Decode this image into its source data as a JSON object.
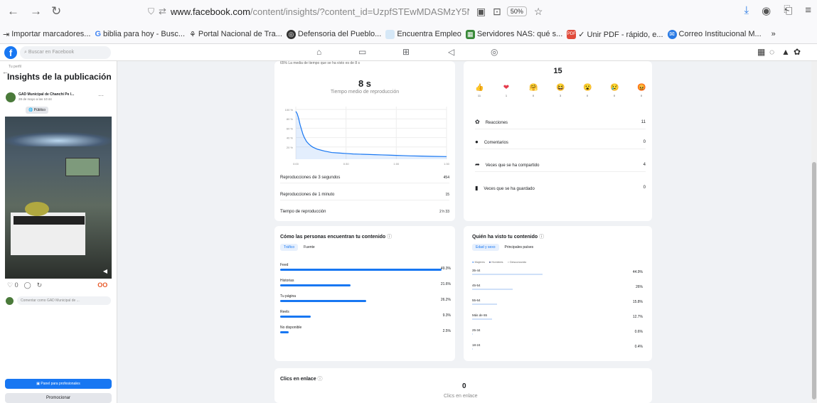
{
  "browser": {
    "url_host": "www.facebook.com",
    "url_path": "/content/insights/?content_id=UzpfSTEwMDASMzY5NDEwNzgzMTQyMTU2NT",
    "zoom": "50%"
  },
  "bookmarks": [
    "Importar marcadores...",
    "biblia para hoy - Busc...",
    "Portal Nacional de Tra...",
    "Defensoria del Pueblo...",
    "Encuentra Empleo",
    "Servidores NAS: qué s...",
    "✓ Unir PDF - rápido, e...",
    "Correo Institucional M..."
  ],
  "fb": {
    "search_placeholder": "Buscar en Facebook"
  },
  "sidebar": {
    "crumb": "Tu perfil",
    "title": "Insights de la publicación",
    "page_name": "GAD Municipal de Chanchi Pe l...",
    "date": "28 de mayo a las 10:44",
    "visibility": "Público",
    "reaction_total": "OO",
    "comment_placeholder": "Comentar como GAD Municipal de ...",
    "pro_button": "Panel para profesionales",
    "promo_button": "Promocionar"
  },
  "video": {
    "clipped_caption": "65% La media de tiempo que se ha visto es de 8 s",
    "avg_value": "8 s",
    "avg_label": "Tiempo medio de reproducción",
    "metrics": [
      {
        "label": "Reproducciones de 3 segundos",
        "value": "454"
      },
      {
        "label": "Reproducciones de 1 minuto",
        "value": "15"
      },
      {
        "label": "Tiempo de reproducción",
        "value": "2 h 33"
      }
    ]
  },
  "chart_data": {
    "type": "line",
    "title": "",
    "xlabel": "",
    "ylabel": "",
    "x": [
      0,
      2,
      4,
      6,
      8,
      10,
      12,
      15,
      18,
      21,
      24,
      30,
      40,
      50,
      60,
      70,
      80,
      90,
      100,
      110,
      120,
      130,
      140,
      150,
      160,
      175,
      190,
      210
    ],
    "y": [
      100,
      95,
      85,
      72,
      62,
      52,
      45,
      37,
      32,
      28,
      25,
      21,
      17,
      14,
      13,
      12,
      11,
      10.5,
      10,
      9.5,
      9,
      8.5,
      8,
      7.5,
      7,
      6.5,
      6,
      5.5
    ],
    "xlim": [
      0,
      210
    ],
    "ylim": [
      0,
      110
    ],
    "xticks": [
      "0:00",
      "0:30",
      "1:00",
      "1:30"
    ],
    "yticks": [
      "100 %",
      "80 %",
      "60 %",
      "40 %",
      "20 %"
    ],
    "line_color": "#1877f2"
  },
  "reactions": {
    "total": "15",
    "items": [
      {
        "icon": "👍",
        "count": "11"
      },
      {
        "icon": "❤",
        "count": "1"
      },
      {
        "icon": "🤗",
        "count": "0"
      },
      {
        "icon": "😆",
        "count": "3"
      },
      {
        "icon": "😮",
        "count": "0"
      },
      {
        "icon": "😢",
        "count": "0"
      },
      {
        "icon": "😡",
        "count": "0"
      }
    ]
  },
  "engagement": [
    {
      "icon": "reactions-icon",
      "label": "Reacciones",
      "value": "11"
    },
    {
      "icon": "comment-icon",
      "label": "Comentarios",
      "value": "0"
    },
    {
      "icon": "share-icon",
      "label": "Veces que se ha compartido",
      "value": "4"
    },
    {
      "icon": "save-icon",
      "label": "Veces que se ha guardado",
      "value": "0"
    }
  ],
  "find": {
    "title": "Cómo las personas encuentran tu contenido",
    "tabs": [
      "Tráfico",
      "Fuente"
    ],
    "rows": [
      {
        "label": "Feed",
        "pct": "49.3%",
        "frac": 0.493
      },
      {
        "label": "Historias",
        "pct": "21.6%",
        "frac": 0.216
      },
      {
        "label": "Tu página",
        "pct": "26.2%",
        "frac": 0.262
      },
      {
        "label": "Reels",
        "pct": "9.3%",
        "frac": 0.093
      },
      {
        "label": "No disponible",
        "pct": "2.5%",
        "frac": 0.025
      }
    ]
  },
  "who": {
    "title": "Quién ha visto tu contenido",
    "tabs": [
      "Edad y sexo",
      "Principales países"
    ],
    "legend": [
      "Mujeres",
      "Hombres",
      "Desconocido"
    ],
    "rows": [
      {
        "label": "35-44",
        "pct": "44.9%",
        "frac": 0.449
      },
      {
        "label": "45-54",
        "pct": "26%",
        "frac": 0.26
      },
      {
        "label": "55-64",
        "pct": "15.8%",
        "frac": 0.158
      },
      {
        "label": "Más de 65",
        "pct": "12.7%",
        "frac": 0.127
      },
      {
        "label": "25-34",
        "pct": "0.6%",
        "frac": 0.006
      },
      {
        "label": "18-24",
        "pct": "0.4%",
        "frac": 0.004
      }
    ]
  },
  "clicks": {
    "title": "Clics en enlace",
    "value": "0",
    "label": "Clics en enlace"
  }
}
